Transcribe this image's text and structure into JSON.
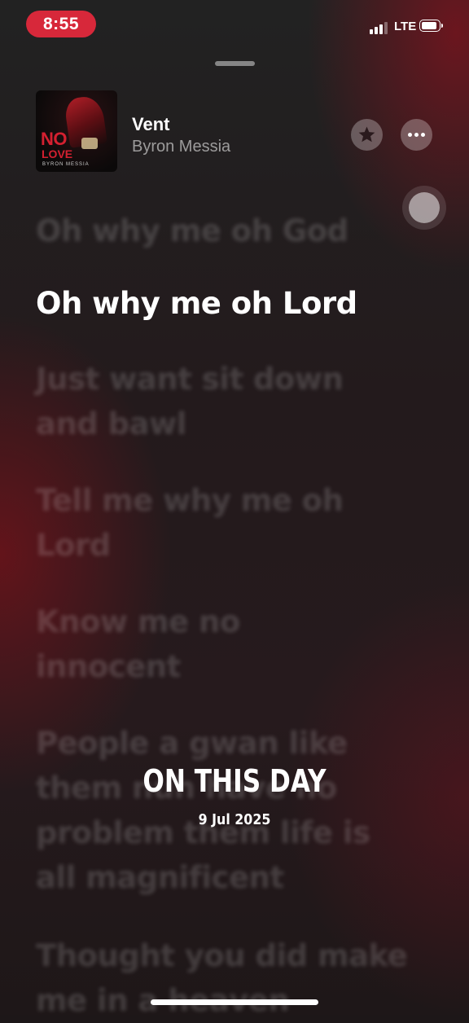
{
  "status_bar": {
    "time": "8:55",
    "network": "LTE"
  },
  "now_playing": {
    "title": "Vent",
    "artist": "Byron Messia",
    "album_art_text": [
      "NO",
      "LOVE",
      "BYRON MESSIA"
    ]
  },
  "lyrics": [
    {
      "text": "Oh why me oh God",
      "state": "past"
    },
    {
      "text": "Oh why me oh Lord",
      "state": "current"
    },
    {
      "text": "Just want sit down and bawl",
      "state": "upcoming"
    },
    {
      "text": "Tell me why me oh Lord",
      "state": "upcoming"
    },
    {
      "text": "Know me no innocent",
      "state": "upcoming"
    },
    {
      "text": "People a gwan like them nuh have no problem them life is all magnificent",
      "state": "upcoming"
    },
    {
      "text": "Thought you did make me in a heaven",
      "state": "upcoming"
    }
  ],
  "overlay": {
    "title": "ON THIS DAY",
    "date": "9 Jul 2025"
  },
  "colors": {
    "time_pill": "#d7283a",
    "background": "#1d1718",
    "accent_red": "#d42030"
  }
}
